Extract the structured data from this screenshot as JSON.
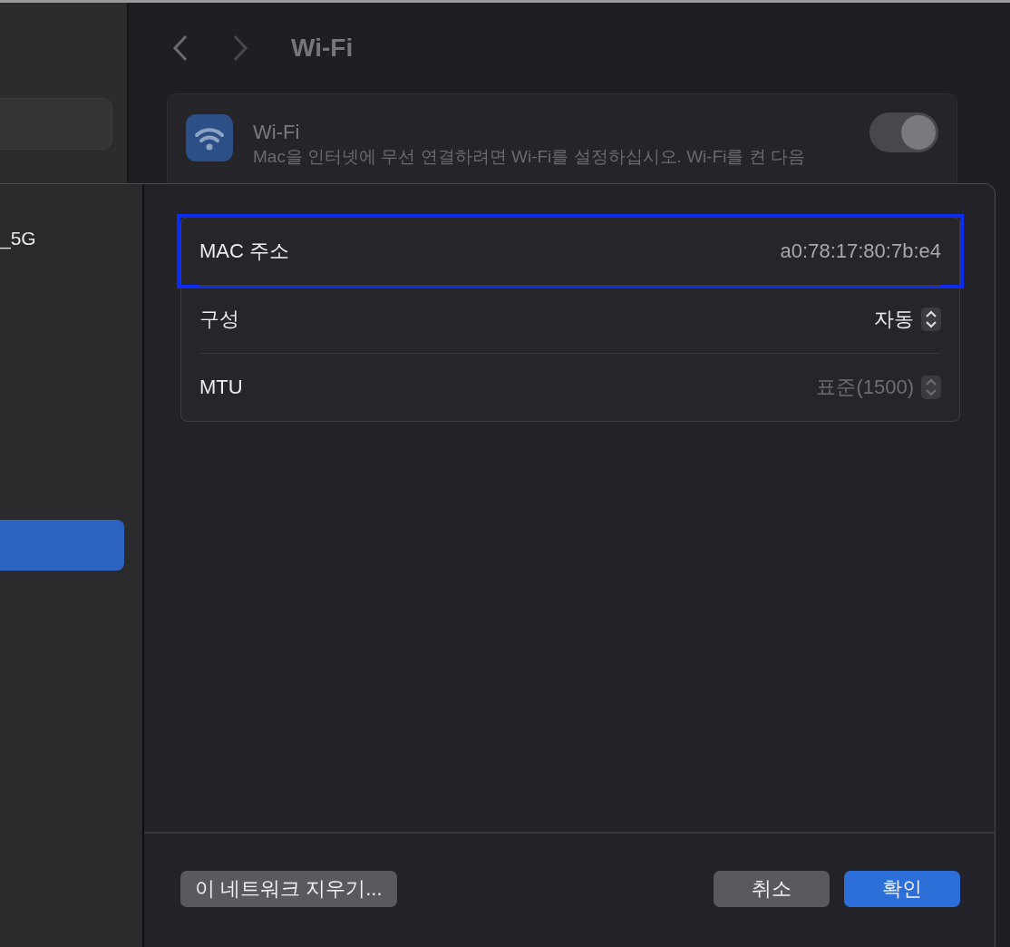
{
  "window": {
    "title": "Wi-Fi"
  },
  "wifi_card": {
    "title": "Wi-Fi",
    "description": "Mac을 인터넷에 무선 연결하려면 Wi-Fi를 설정하십시오. Wi-Fi를 켠 다음",
    "toggle": {
      "on": true
    }
  },
  "dialog": {
    "network_list": [
      {
        "name": "_5G",
        "selected": false
      },
      {
        "selected": true
      }
    ],
    "settings": [
      {
        "kind": "value",
        "label": "MAC 주소",
        "value": "a0:78:17:80:7b:e4",
        "highlighted": true
      },
      {
        "kind": "popup",
        "label": "구성",
        "value": "자동",
        "disabled": false,
        "highlighted": false
      },
      {
        "kind": "popup",
        "label": "MTU",
        "value": "표준(1500)",
        "disabled": true,
        "highlighted": false
      }
    ],
    "forget_button": "이 네트워크 지우기...",
    "cancel_button": "취소",
    "ok_button": "확인"
  }
}
